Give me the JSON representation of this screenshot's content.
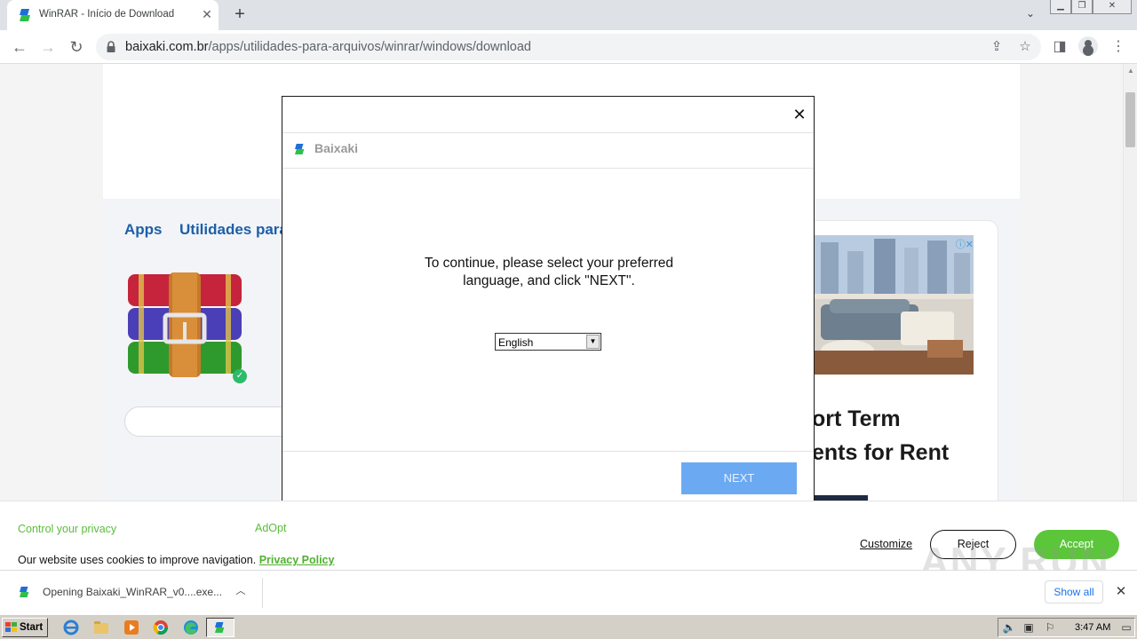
{
  "browser": {
    "tab_title": "WinRAR - Início de Download",
    "url_host": "baixaki.com.br",
    "url_path": "/apps/utilidades-para-arquivos/winrar/windows/download"
  },
  "page": {
    "breadcrumb_apps": "Apps",
    "breadcrumb_category": "Utilidades para A",
    "ad_line1": "ort Term",
    "ad_line2": "ents for Rent"
  },
  "modal": {
    "brand": "Baixaki",
    "message_line1": "To continue, please select your preferred",
    "message_line2": "language, and click \"NEXT\".",
    "language_selected": "English",
    "next_label": "NEXT",
    "close_symbol": "✕"
  },
  "cookie": {
    "title": "Control your privacy",
    "brand": "AdOpt",
    "text": "Our website uses cookies to improve navigation.",
    "privacy_link": "Privacy Policy",
    "customize": "Customize",
    "reject": "Reject",
    "accept": "Accept"
  },
  "download_shelf": {
    "file_status": "Opening Baixaki_WinRAR_v0....exe...",
    "show_all": "Show all"
  },
  "taskbar": {
    "start_label": "Start",
    "clock": "3:47 AM"
  },
  "watermark": "ANY RUN",
  "colors": {
    "accent_green": "#5cc63b",
    "link_blue": "#1d5fa8",
    "next_button": "#6ca9f3"
  }
}
